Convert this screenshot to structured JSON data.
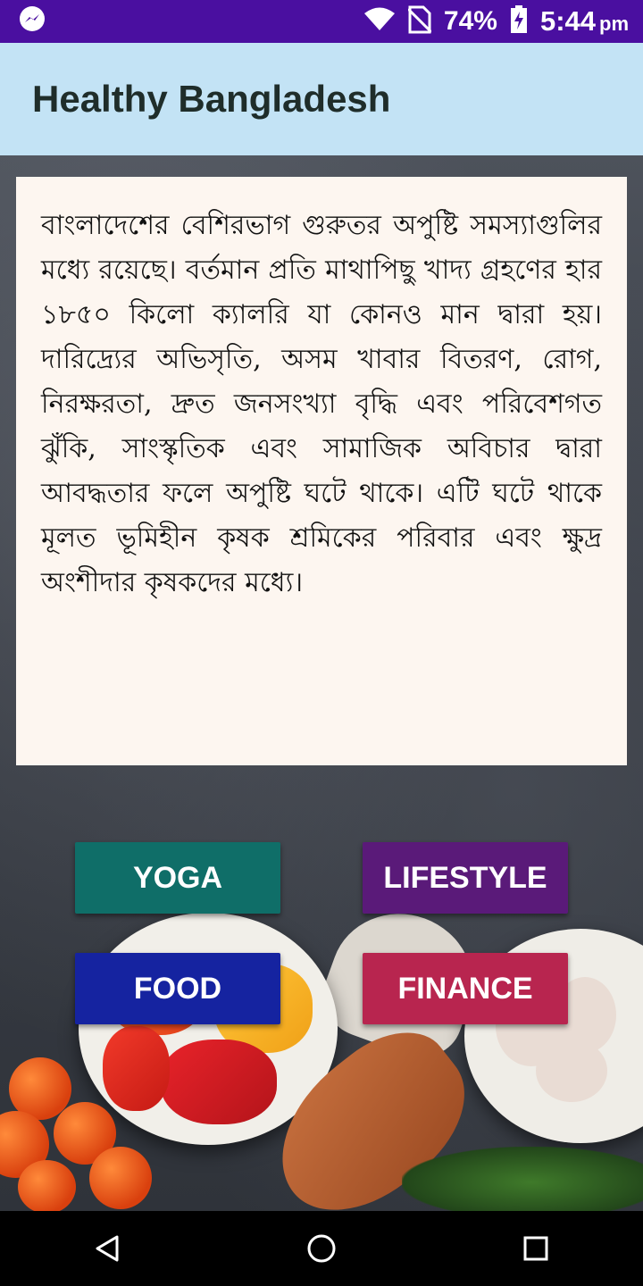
{
  "status_bar": {
    "app_icon": "messenger-icon",
    "battery": "74%",
    "time": "5:44",
    "ampm": "pm"
  },
  "app_bar": {
    "title": "Healthy Bangladesh"
  },
  "card": {
    "text": "বাংলাদেশের বেশিরভাগ গুরুতর অপুষ্টি সমস্যাগুলির মধ্যে রয়েছে। বর্তমান প্রতি মাথাপিছু খাদ্য গ্রহণের হার ১৮৫০ কিলো ক্যালরি যা কোনও মান দ্বারা হয়। দারিদ্র্যের অভিসৃতি, অসম খাবার বিতরণ, রোগ, নিরক্ষরতা, দ্রুত জনসংখ্যা বৃদ্ধি এবং পরিবেশগত ঝুঁকি, সাংস্কৃতিক এবং সামাজিক অবিচার দ্বারা আবদ্ধতার ফলে অপুষ্টি ঘটে থাকে। এটি ঘটে থাকে মূলত ভূমিহীন কৃষক শ্রমিকের পরিবার এবং ক্ষুদ্র অংশীদার কৃষকদের মধ্যে।"
  },
  "buttons": {
    "yoga": {
      "label": "YOGA",
      "color": "#0f6e68"
    },
    "lifestyle": {
      "label": "LIFESTYLE",
      "color": "#5a1a79"
    },
    "food": {
      "label": "FOOD",
      "color": "#1523a0"
    },
    "finance": {
      "label": "FINANCE",
      "color": "#b8254f"
    }
  },
  "colors": {
    "status_bar": "#4a0fa0",
    "app_bar": "#c3e3f5",
    "card": "#fdf6f0"
  },
  "nav": {
    "back": "back-icon",
    "home": "home-icon",
    "recents": "recents-icon"
  }
}
